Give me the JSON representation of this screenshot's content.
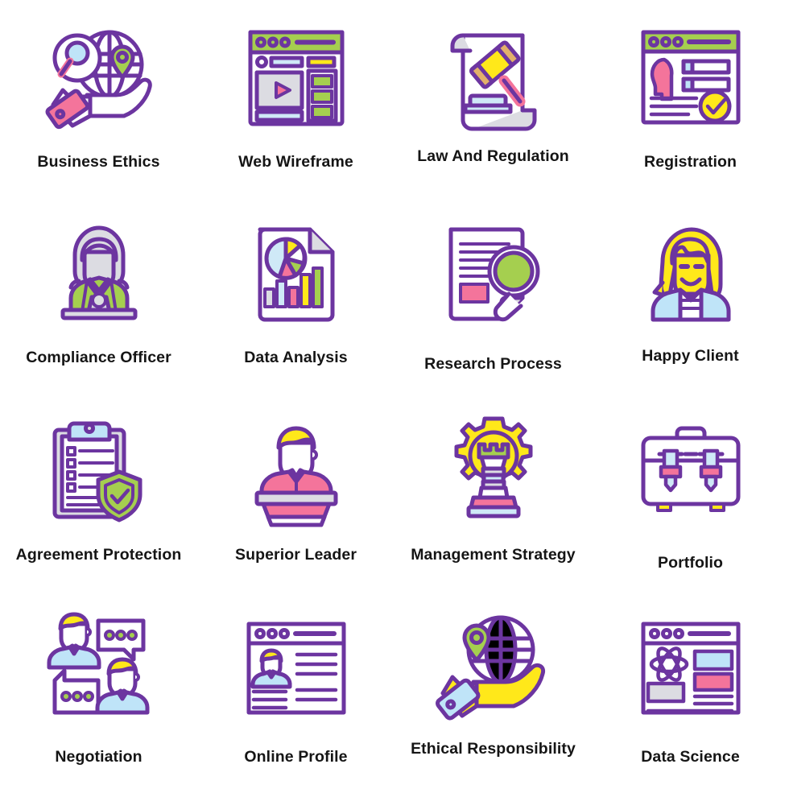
{
  "palette": {
    "outline": "#6c35a0",
    "outline_dark": "#5b2d8e",
    "green": "#a5cf4f",
    "green_dark": "#8cbb3e",
    "yellow": "#ffe81a",
    "yellow_soft": "#f5e04a",
    "pink": "#f4749b",
    "pink_deep": "#ef5f8c",
    "blue_light": "#bfe4f8",
    "blue_pale": "#cfe9f7",
    "grey": "#dcdce2",
    "grey_dark": "#c9c9d2",
    "white": "#ffffff",
    "text": "#151515",
    "background": "#ffffff"
  },
  "grid": {
    "columns": 4,
    "rows": 4,
    "total_icons": 16
  },
  "icons": [
    {
      "id": "business-ethics",
      "label": "Business Ethics",
      "glyph": "hand-globe-magnifier-pin",
      "row": 1,
      "col": 1
    },
    {
      "id": "web-wireframe",
      "label": "Web Wireframe",
      "glyph": "browser-wireframe-play",
      "row": 1,
      "col": 2
    },
    {
      "id": "law-and-regulation",
      "label": "Law And Regulation",
      "glyph": "scroll-gavel",
      "row": 1,
      "col": 3
    },
    {
      "id": "registration",
      "label": "Registration",
      "glyph": "browser-form-check",
      "row": 1,
      "col": 4
    },
    {
      "id": "compliance-officer",
      "label": "Compliance Officer",
      "glyph": "woman-suit-avatar",
      "row": 2,
      "col": 1
    },
    {
      "id": "data-analysis",
      "label": "Data Analysis",
      "glyph": "document-pie-bars",
      "row": 2,
      "col": 2
    },
    {
      "id": "research-process",
      "label": "Research Process",
      "glyph": "document-magnifier",
      "row": 2,
      "col": 3
    },
    {
      "id": "happy-client",
      "label": "Happy Client",
      "glyph": "smiling-woman-avatar",
      "row": 2,
      "col": 4
    },
    {
      "id": "agreement-protection",
      "label": "Agreement Protection",
      "glyph": "clipboard-shield-check",
      "row": 3,
      "col": 1
    },
    {
      "id": "superior-leader",
      "label": "Superior Leader",
      "glyph": "speaker-podium",
      "row": 3,
      "col": 2
    },
    {
      "id": "management-strategy",
      "label": "Management Strategy",
      "glyph": "gear-bulb-chess-rook",
      "row": 3,
      "col": 3
    },
    {
      "id": "portfolio",
      "label": "Portfolio",
      "glyph": "briefcase-buckles",
      "row": 3,
      "col": 4
    },
    {
      "id": "negotiation",
      "label": "Negotiation",
      "glyph": "two-people-chat-bubbles",
      "row": 4,
      "col": 1
    },
    {
      "id": "online-profile",
      "label": "Online Profile",
      "glyph": "browser-profile-card",
      "row": 4,
      "col": 2
    },
    {
      "id": "ethical-responsibility",
      "label": "Ethical Responsibility",
      "glyph": "hand-globe-pin",
      "row": 4,
      "col": 3
    },
    {
      "id": "data-science",
      "label": "Data Science",
      "glyph": "browser-atom-blocks",
      "row": 4,
      "col": 4
    }
  ]
}
